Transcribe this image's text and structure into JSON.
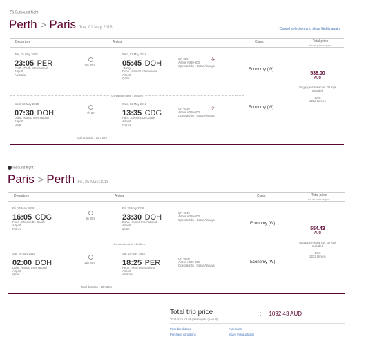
{
  "outbound": {
    "tag": "Outbound flight",
    "from": "Perth",
    "to": "Paris",
    "date": "Tue, 01 May 2018",
    "cancel_link": "Cancel selection and show flights again",
    "headers": {
      "departure": "Departure",
      "arrival": "Arrival",
      "class": "Class",
      "total_price": "Total price",
      "total_price_sub": "for all passengers"
    },
    "seg1": {
      "dep_date": "Tue, 01 May 2018",
      "dep_time": "23:05",
      "dep_code": "PER",
      "dep_l1": "Perth , Perth International",
      "dep_l2": "Airport",
      "dep_l3": "Australia",
      "duration": "11h 40m",
      "arr_date": "Wed, 02 May 2018",
      "arr_time": "05:45",
      "arr_code": "DOH",
      "arr_l0": "+1Day",
      "arr_l1": "Doha , Hamad International",
      "arr_l2": "Airport",
      "arr_l3": "Qatar",
      "flight": "QR 889",
      "aircraft": "Airbus A380-800",
      "operated": "Operated by : Qatar Airways",
      "class": "Economy (W)"
    },
    "connection": "Connection time : 1h 45m",
    "seg2": {
      "dep_date": "Wed, 02 May 2018",
      "dep_time": "07:30",
      "dep_code": "DOH",
      "dep_l1": "Doha, Hamad International",
      "dep_l2": "Airport",
      "dep_l3": "Qatar",
      "duration": "7h 5m",
      "arr_date": "Wed, 02 May 2018",
      "arr_time": "13:35",
      "arr_code": "CDG",
      "arr_l1": "Paris , Charles De Gaulle",
      "arr_l2": "Airport",
      "arr_l3": "France",
      "flight": "QR 0039",
      "aircraft": "Airbus A380-800",
      "operated": "Operated by : Qatar Airways",
      "class": "Economy (W)"
    },
    "price": "538.00",
    "currency": "AUD",
    "baggage": "Baggage Allowance : 30 Kgs",
    "baggage2": "Included",
    "earn": "Earn",
    "earn2": "2222 Qmiles",
    "total_duration": "Total duration : 20h 30m"
  },
  "inbound": {
    "tag": "Inbound flight",
    "from": "Paris",
    "to": "Perth",
    "date": "Fri, 25 May 2018",
    "headers": {
      "departure": "Departure",
      "arrival": "Arrival",
      "class": "Class",
      "total_price": "Total price",
      "total_price_sub": "for all passengers"
    },
    "seg1": {
      "dep_date": "Fri, 25 May 2018",
      "dep_time": "16:05",
      "dep_code": "CDG",
      "dep_l1": "Paris , Charles De Gaulle",
      "dep_l2": "Airport",
      "dep_l3": "France",
      "duration": "6h 25m",
      "arr_date": "Fri, 25 May 2018",
      "arr_time": "23:30",
      "arr_code": "DOH",
      "arr_l1": "Doha, Hamad International",
      "arr_l2": "Airport",
      "arr_l3": "Qatar",
      "flight": "QR 0040",
      "aircraft": "Airbus A380-800",
      "operated": "Operated by : Qatar Airways",
      "class": "Economy (W)"
    },
    "connection": "Connection time : 2h 30m",
    "seg2": {
      "dep_date": "Sat, 26 May 2018",
      "dep_time": "02:00",
      "dep_code": "DOH",
      "dep_l1": "Doha, Hamad International",
      "dep_l2": "Airport",
      "dep_l3": "Qatar",
      "duration": "11h 25m",
      "arr_date": "Sat, 26 May 2018",
      "arr_time": "18:25",
      "arr_code": "PER",
      "arr_l1": "Perth , Perth International",
      "arr_l2": "Airport",
      "arr_l3": "Australia",
      "flight": "QR 0900",
      "aircraft": "Airbus A380-800",
      "operated": "Operated by : Qatar Airways",
      "class": "Economy (W)"
    },
    "price": "554.43",
    "currency": "AUD",
    "baggage": "Baggage Allowance : 30 Kgs",
    "baggage2": "Included",
    "earn": "Earn",
    "earn2": "2222 Qmiles",
    "total_duration": "Total duration : 20h 30m"
  },
  "summary": {
    "title": "Total trip price",
    "subtitle": "Total price for all passengers (1Adult)",
    "amount": "1092.43 AUD",
    "links": [
      "Price breakdown",
      "Fare rules",
      "Purchase conditions",
      "Share this quotation"
    ]
  },
  "colors": {
    "accent": "#5c0632",
    "link": "#3b6fb6"
  }
}
